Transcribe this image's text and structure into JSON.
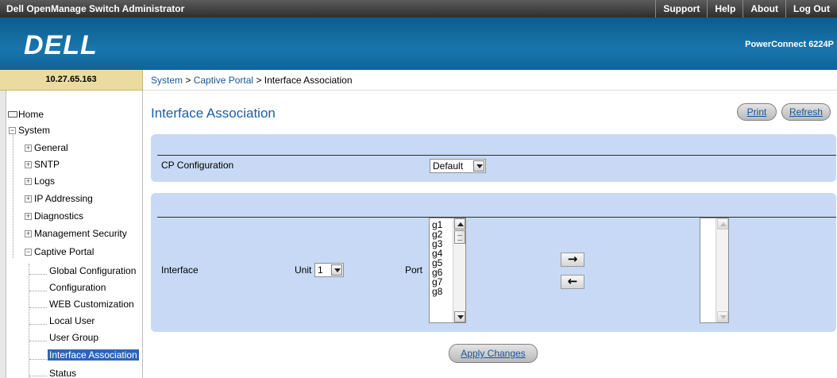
{
  "topbar": {
    "app_title": "Dell OpenManage Switch Administrator",
    "links": [
      "Support",
      "Help",
      "About",
      "Log Out"
    ]
  },
  "brand": {
    "logo": "DELL",
    "model": "PowerConnect 6224P"
  },
  "ip_address": "10.27.65.163",
  "breadcrumb": {
    "items": [
      "System",
      "Captive Portal"
    ],
    "separator": ">",
    "current": "Interface Association"
  },
  "sidebar": {
    "home": "Home",
    "system": "System",
    "groups": [
      "General",
      "SNTP",
      "Logs",
      "IP Addressing",
      "Diagnostics",
      "Management Security",
      "Captive Portal"
    ],
    "captive_portal_items": [
      "Global Configuration",
      "Configuration",
      "WEB Customization",
      "Local User",
      "User Group",
      "Interface Association",
      "Status"
    ],
    "selected": "Interface Association"
  },
  "page": {
    "title": "Interface Association",
    "print_label": "Print",
    "refresh_label": "Refresh",
    "apply_label": "Apply Changes"
  },
  "cp_config": {
    "label": "CP Configuration",
    "value": "Default"
  },
  "interface": {
    "label": "Interface",
    "unit_label": "Unit",
    "unit_value": "1",
    "port_label": "Port",
    "ports": [
      "g1",
      "g2",
      "g3",
      "g4",
      "g5",
      "g6",
      "g7",
      "g8"
    ],
    "add_arrow": "→",
    "remove_arrow": "←"
  },
  "colors": {
    "panel_bg": "#c7d9f4",
    "title_blue": "#1c5fa3",
    "selected_nav": "#2c66b7"
  }
}
